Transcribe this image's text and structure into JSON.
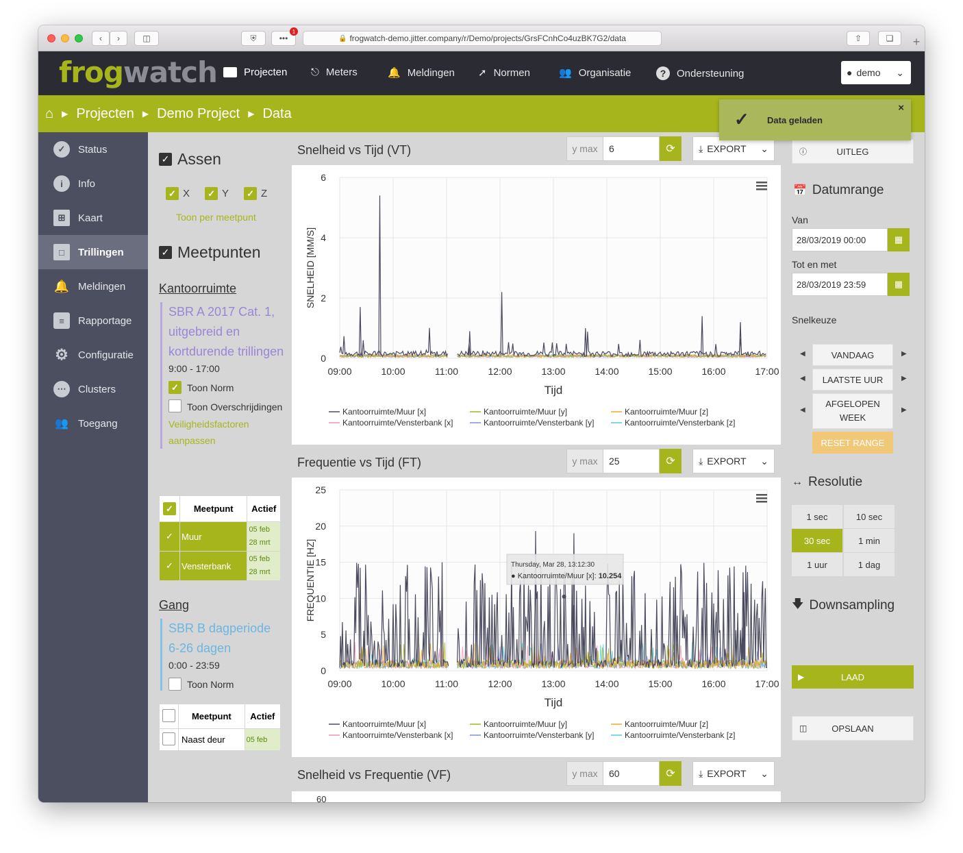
{
  "browser": {
    "url": "frogwatch-demo.jitter.company/r/Demo/projects/GrsFCnhCo4uzBK7G2/data",
    "badge": "1"
  },
  "logo": {
    "part1": "fr",
    "part2": "og",
    "part3": "watch"
  },
  "topnav": {
    "items": [
      "Projecten",
      "Meters",
      "Meldingen",
      "Normen",
      "Organisatie",
      "Ondersteuning"
    ],
    "user": "demo"
  },
  "breadcrumb": {
    "items": [
      "Projecten",
      "Demo Project",
      "Data"
    ]
  },
  "toast": {
    "message": "Data geladen"
  },
  "sidebar": {
    "items": [
      "Status",
      "Info",
      "Kaart",
      "Trillingen",
      "Meldingen",
      "Rapportage",
      "Configuratie",
      "Clusters",
      "Toegang"
    ],
    "active": "Trillingen"
  },
  "panel": {
    "axes_title": "Assen",
    "axes": [
      "X",
      "Y",
      "Z"
    ],
    "per_point_link": "Toon per meetpunt",
    "points_title": "Meetpunten",
    "group1": {
      "name": "Kantoorruimte",
      "norm": "SBR A 2017 Cat. 1, uitgebreid en kortdurende trillingen",
      "hours": "9:00 - 17:00",
      "show_norm": "Toon Norm",
      "show_exceed": "Toon Overschrijdingen",
      "factors_link": "Veiligheidsfactoren aanpassen",
      "table": {
        "headers": [
          "Meetpunt",
          "Actief"
        ],
        "rows": [
          {
            "name": "Muur",
            "from": "05 feb",
            "to": "28 mrt"
          },
          {
            "name": "Vensterbank",
            "from": "05 feb",
            "to": "28 mrt"
          }
        ]
      }
    },
    "group2": {
      "name": "Gang",
      "norm": "SBR B dagperiode 6-26 dagen",
      "hours": "0:00 - 23:59",
      "show_norm": "Toon Norm",
      "table": {
        "headers": [
          "Meetpunt",
          "Actief"
        ],
        "rows": [
          {
            "name": "Naast deur",
            "from": "05 feb"
          }
        ]
      }
    }
  },
  "charts": {
    "ymax_label": "y max",
    "export_label": "EXPORT",
    "vt": {
      "title": "Snelheid vs Tijd (VT)",
      "ymax": "6"
    },
    "ft": {
      "title": "Frequentie vs Tijd (FT)",
      "ymax": "25"
    },
    "vf": {
      "title": "Snelheid vs Frequentie (VF)",
      "ymax": "60",
      "first_tick": "60"
    },
    "tooltip": {
      "date": "Thursday, Mar 28, 13:12:30",
      "series": "Kantoorruimte/Muur [x]:",
      "value": "10.254"
    }
  },
  "chart_data": [
    {
      "type": "line",
      "title": "",
      "xlabel": "Tijd",
      "ylabel": "SNELHEID [MM/S]",
      "x_ticks": [
        "09:00",
        "10:00",
        "11:00",
        "12:00",
        "13:00",
        "14:00",
        "15:00",
        "16:00",
        "17:00"
      ],
      "y_ticks": [
        "0",
        "2",
        "4",
        "6"
      ],
      "ylim": [
        0,
        6
      ],
      "series": [
        {
          "name": "Kantoorruimte/Muur [x]",
          "color": "#4a4a5e"
        },
        {
          "name": "Kantoorruimte/Muur [y]",
          "color": "#a6b51c"
        },
        {
          "name": "Kantoorruimte/Muur [z]",
          "color": "#f5a623"
        },
        {
          "name": "Kantoorruimte/Vensterbank [x]",
          "color": "#f48fb1"
        },
        {
          "name": "Kantoorruimte/Vensterbank [y]",
          "color": "#7b8fd6"
        },
        {
          "name": "Kantoorruimte/Vensterbank [z]",
          "color": "#4dd0e1"
        }
      ],
      "peaks": [
        {
          "x": "09:23",
          "y": 1.7
        },
        {
          "x": "09:45",
          "y": 5.4
        },
        {
          "x": "11:26",
          "y": 0.9
        },
        {
          "x": "12:02",
          "y": 2.2
        },
        {
          "x": "13:36",
          "y": 1.0
        },
        {
          "x": "15:47",
          "y": 1.4
        },
        {
          "x": "16:30",
          "y": 1.2
        }
      ]
    },
    {
      "type": "line",
      "title": "",
      "xlabel": "Tijd",
      "ylabel": "FREQUENTIE [HZ]",
      "x_ticks": [
        "09:00",
        "10:00",
        "11:00",
        "12:00",
        "13:00",
        "14:00",
        "15:00",
        "16:00",
        "17:00"
      ],
      "y_ticks": [
        "0",
        "5",
        "10",
        "15",
        "20",
        "25"
      ],
      "ylim": [
        0,
        25
      ],
      "series": [
        {
          "name": "Kantoorruimte/Muur [x]",
          "color": "#4a4a5e"
        },
        {
          "name": "Kantoorruimte/Muur [y]",
          "color": "#a6b51c"
        },
        {
          "name": "Kantoorruimte/Muur [z]",
          "color": "#f5a623"
        },
        {
          "name": "Kantoorruimte/Vensterbank [x]",
          "color": "#f48fb1"
        },
        {
          "name": "Kantoorruimte/Vensterbank [y]",
          "color": "#7b8fd6"
        },
        {
          "name": "Kantoorruimte/Vensterbank [z]",
          "color": "#4dd0e1"
        }
      ],
      "peaks": [
        {
          "x": "12:40",
          "y": 19.3
        },
        {
          "x": "13:23",
          "y": 19.0
        },
        {
          "x": "13:12",
          "y": 10.254
        },
        {
          "x": "16:33",
          "y": 13.6
        }
      ]
    }
  ],
  "right": {
    "explain": "UITLEG",
    "daterange_title": "Datumrange",
    "from_label": "Van",
    "from_value": "28/03/2019 00:00",
    "to_label": "Tot en met",
    "to_value": "28/03/2019 23:59",
    "quick_title": "Snelkeuze",
    "quick": [
      "VANDAAG",
      "LAATSTE UUR",
      "AFGELOPEN WEEK"
    ],
    "reset": "RESET RANGE",
    "resolution_title": "Resolutie",
    "resolutions": [
      "1 sec",
      "10 sec",
      "30 sec",
      "1 min",
      "1 uur",
      "1 dag"
    ],
    "resolution_active": "30 sec",
    "downsampling_title": "Downsampling",
    "load": "LAAD",
    "save": "OPSLAAN"
  }
}
